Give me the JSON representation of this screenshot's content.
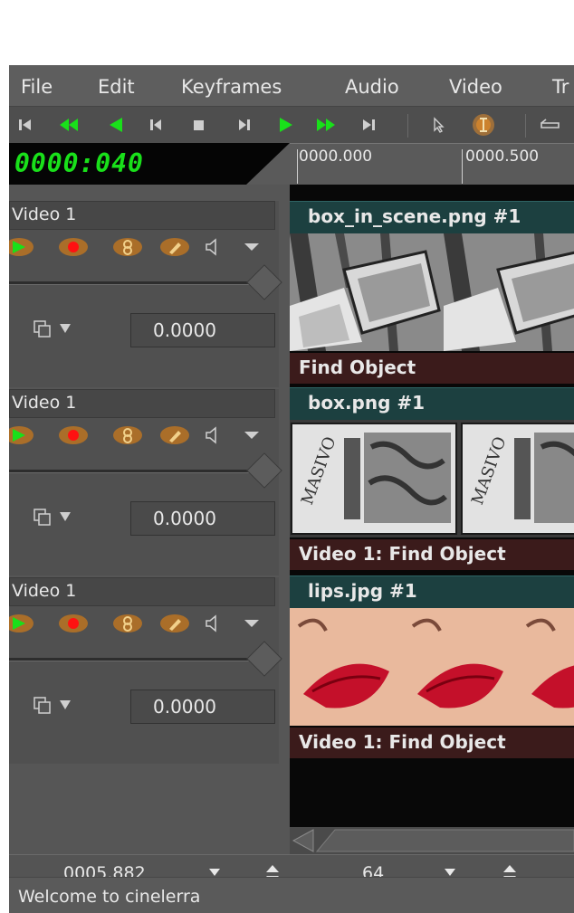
{
  "menu": [
    "File",
    "Edit",
    "Keyframes",
    "Audio",
    "Video",
    "Tr"
  ],
  "toolbar": {
    "buttons": [
      "rewind-to-start",
      "fast-reverse",
      "reverse-play",
      "frame-reverse",
      "stop",
      "frame-forward",
      "play",
      "fast-forward",
      "jump-to-end",
      "arrow-mode",
      "ibeam-mode",
      "keyframe-mode"
    ],
    "accent_green": "#19e01a",
    "accent_orange": "#e08a2a"
  },
  "clock": {
    "time": "0000:040"
  },
  "ruler": {
    "labels": [
      "0000.000",
      "0000.500"
    ]
  },
  "tracks": [
    {
      "name": "Video 1",
      "nudge": "0.0000",
      "edit_title": "box_in_scene.png #1",
      "plugin": "Find Object"
    },
    {
      "name": "Video 1",
      "nudge": "0.0000",
      "edit_title": "box.png #1",
      "plugin": "Video 1: Find Object"
    },
    {
      "name": "Video 1",
      "nudge": "0.0000",
      "edit_title": "lips.jpg #1",
      "plugin": "Video 1: Find Object"
    }
  ],
  "zoombar": {
    "time": "0005.882",
    "zoom": "64"
  },
  "status": {
    "text": "Welcome to cinelerra"
  }
}
